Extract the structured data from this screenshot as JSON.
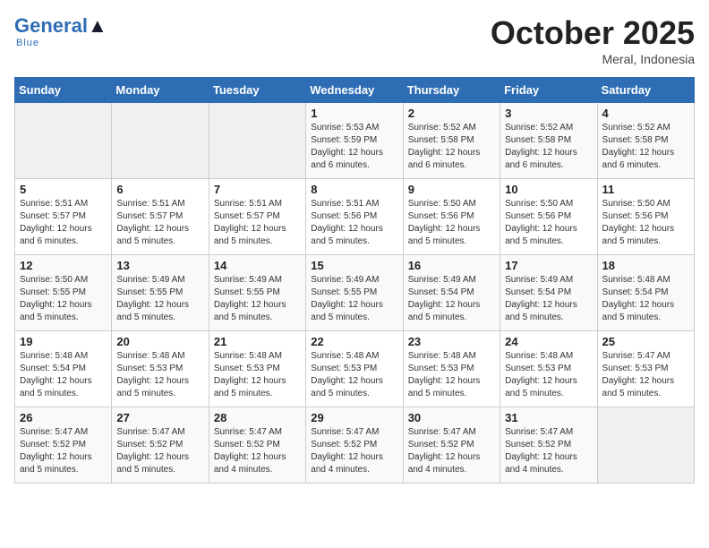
{
  "logo": {
    "name_part1": "General",
    "name_part2": "Blue"
  },
  "header": {
    "month": "October 2025",
    "location": "Meral, Indonesia"
  },
  "weekdays": [
    "Sunday",
    "Monday",
    "Tuesday",
    "Wednesday",
    "Thursday",
    "Friday",
    "Saturday"
  ],
  "weeks": [
    [
      {
        "day": "",
        "info": ""
      },
      {
        "day": "",
        "info": ""
      },
      {
        "day": "",
        "info": ""
      },
      {
        "day": "1",
        "info": "Sunrise: 5:53 AM\nSunset: 5:59 PM\nDaylight: 12 hours\nand 6 minutes."
      },
      {
        "day": "2",
        "info": "Sunrise: 5:52 AM\nSunset: 5:58 PM\nDaylight: 12 hours\nand 6 minutes."
      },
      {
        "day": "3",
        "info": "Sunrise: 5:52 AM\nSunset: 5:58 PM\nDaylight: 12 hours\nand 6 minutes."
      },
      {
        "day": "4",
        "info": "Sunrise: 5:52 AM\nSunset: 5:58 PM\nDaylight: 12 hours\nand 6 minutes."
      }
    ],
    [
      {
        "day": "5",
        "info": "Sunrise: 5:51 AM\nSunset: 5:57 PM\nDaylight: 12 hours\nand 6 minutes."
      },
      {
        "day": "6",
        "info": "Sunrise: 5:51 AM\nSunset: 5:57 PM\nDaylight: 12 hours\nand 5 minutes."
      },
      {
        "day": "7",
        "info": "Sunrise: 5:51 AM\nSunset: 5:57 PM\nDaylight: 12 hours\nand 5 minutes."
      },
      {
        "day": "8",
        "info": "Sunrise: 5:51 AM\nSunset: 5:56 PM\nDaylight: 12 hours\nand 5 minutes."
      },
      {
        "day": "9",
        "info": "Sunrise: 5:50 AM\nSunset: 5:56 PM\nDaylight: 12 hours\nand 5 minutes."
      },
      {
        "day": "10",
        "info": "Sunrise: 5:50 AM\nSunset: 5:56 PM\nDaylight: 12 hours\nand 5 minutes."
      },
      {
        "day": "11",
        "info": "Sunrise: 5:50 AM\nSunset: 5:56 PM\nDaylight: 12 hours\nand 5 minutes."
      }
    ],
    [
      {
        "day": "12",
        "info": "Sunrise: 5:50 AM\nSunset: 5:55 PM\nDaylight: 12 hours\nand 5 minutes."
      },
      {
        "day": "13",
        "info": "Sunrise: 5:49 AM\nSunset: 5:55 PM\nDaylight: 12 hours\nand 5 minutes."
      },
      {
        "day": "14",
        "info": "Sunrise: 5:49 AM\nSunset: 5:55 PM\nDaylight: 12 hours\nand 5 minutes."
      },
      {
        "day": "15",
        "info": "Sunrise: 5:49 AM\nSunset: 5:55 PM\nDaylight: 12 hours\nand 5 minutes."
      },
      {
        "day": "16",
        "info": "Sunrise: 5:49 AM\nSunset: 5:54 PM\nDaylight: 12 hours\nand 5 minutes."
      },
      {
        "day": "17",
        "info": "Sunrise: 5:49 AM\nSunset: 5:54 PM\nDaylight: 12 hours\nand 5 minutes."
      },
      {
        "day": "18",
        "info": "Sunrise: 5:48 AM\nSunset: 5:54 PM\nDaylight: 12 hours\nand 5 minutes."
      }
    ],
    [
      {
        "day": "19",
        "info": "Sunrise: 5:48 AM\nSunset: 5:54 PM\nDaylight: 12 hours\nand 5 minutes."
      },
      {
        "day": "20",
        "info": "Sunrise: 5:48 AM\nSunset: 5:53 PM\nDaylight: 12 hours\nand 5 minutes."
      },
      {
        "day": "21",
        "info": "Sunrise: 5:48 AM\nSunset: 5:53 PM\nDaylight: 12 hours\nand 5 minutes."
      },
      {
        "day": "22",
        "info": "Sunrise: 5:48 AM\nSunset: 5:53 PM\nDaylight: 12 hours\nand 5 minutes."
      },
      {
        "day": "23",
        "info": "Sunrise: 5:48 AM\nSunset: 5:53 PM\nDaylight: 12 hours\nand 5 minutes."
      },
      {
        "day": "24",
        "info": "Sunrise: 5:48 AM\nSunset: 5:53 PM\nDaylight: 12 hours\nand 5 minutes."
      },
      {
        "day": "25",
        "info": "Sunrise: 5:47 AM\nSunset: 5:53 PM\nDaylight: 12 hours\nand 5 minutes."
      }
    ],
    [
      {
        "day": "26",
        "info": "Sunrise: 5:47 AM\nSunset: 5:52 PM\nDaylight: 12 hours\nand 5 minutes."
      },
      {
        "day": "27",
        "info": "Sunrise: 5:47 AM\nSunset: 5:52 PM\nDaylight: 12 hours\nand 5 minutes."
      },
      {
        "day": "28",
        "info": "Sunrise: 5:47 AM\nSunset: 5:52 PM\nDaylight: 12 hours\nand 4 minutes."
      },
      {
        "day": "29",
        "info": "Sunrise: 5:47 AM\nSunset: 5:52 PM\nDaylight: 12 hours\nand 4 minutes."
      },
      {
        "day": "30",
        "info": "Sunrise: 5:47 AM\nSunset: 5:52 PM\nDaylight: 12 hours\nand 4 minutes."
      },
      {
        "day": "31",
        "info": "Sunrise: 5:47 AM\nSunset: 5:52 PM\nDaylight: 12 hours\nand 4 minutes."
      },
      {
        "day": "",
        "info": ""
      }
    ]
  ]
}
